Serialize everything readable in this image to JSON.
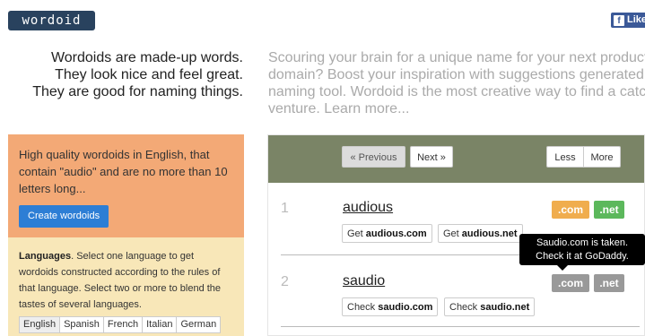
{
  "header": {
    "logo_text": "wordoid",
    "facebook_label": "Like"
  },
  "tagline": {
    "lines": [
      "Wordoids are made-up words.",
      "They look nice and feel great.",
      "They are good for naming things."
    ]
  },
  "intro": {
    "lines": [
      "Scouring your brain for a unique name for your next product, c",
      "domain? Boost your inspiration with suggestions generated b",
      "naming tool. Wordoid is the most creative way to find a catchy",
      "venture. Learn more..."
    ]
  },
  "settings": {
    "description_lines": [
      "High quality wordoids in English, that",
      "contain \"audio\" and are no more than 10",
      "letters long..."
    ],
    "create_button": "Create wordoids",
    "languages_heading": "Languages",
    "languages_text": ". Select one language to get wordoids constructed according to the rules of that language. Select two or more to blend the tastes of several languages.",
    "languages": [
      "English",
      "Spanish",
      "French",
      "Italian",
      "German"
    ],
    "selected_language": "English"
  },
  "results_nav": {
    "previous": "« Previous",
    "next": "Next »",
    "less": "Less",
    "more": "More"
  },
  "results": [
    {
      "number": "1",
      "word": "audious",
      "com": ".com",
      "net": ".net",
      "com_color": "#f0ad4e",
      "net_color": "#5cb85c",
      "actions": [
        {
          "prefix": "Get ",
          "domain": "audious.com"
        },
        {
          "prefix": "Get ",
          "domain": "audious.net"
        }
      ]
    },
    {
      "number": "2",
      "word": "saudio",
      "com": ".com",
      "net": ".net",
      "com_color": "#999999",
      "net_color": "#999999",
      "actions": [
        {
          "prefix": "Check ",
          "domain": "saudio.com"
        },
        {
          "prefix": "Check ",
          "domain": "saudio.net"
        }
      ]
    }
  ],
  "tooltip": {
    "line1": "Saudio.com is taken.",
    "line2": "Check it at GoDaddy."
  }
}
